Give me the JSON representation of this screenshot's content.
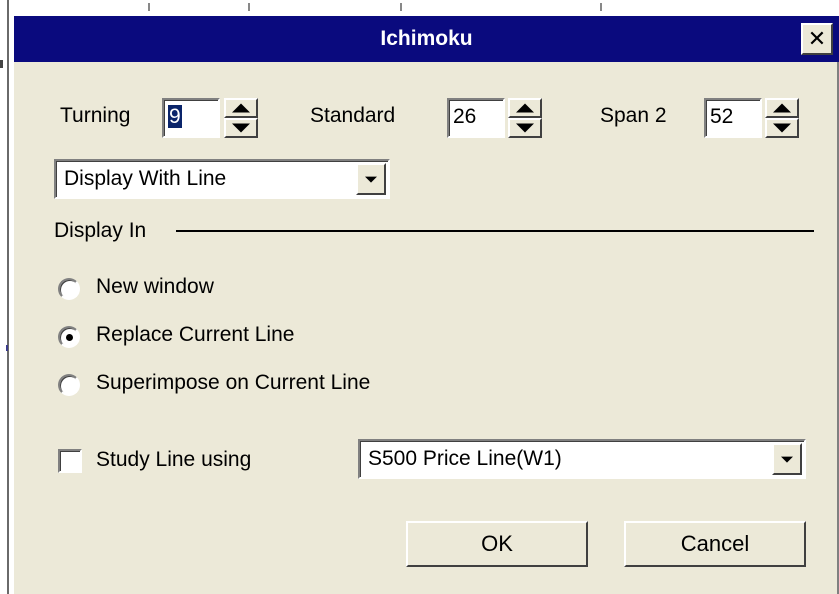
{
  "dialog": {
    "title": "Ichimoku",
    "close_label": "✕"
  },
  "params": {
    "turning": {
      "label": "Turning",
      "value": "9"
    },
    "standard": {
      "label": "Standard",
      "value": "26"
    },
    "span2": {
      "label": "Span 2",
      "value": "52"
    }
  },
  "display_mode": {
    "selected": "Display With Line"
  },
  "display_in": {
    "label": "Display In",
    "options": [
      {
        "label": "New window",
        "checked": false
      },
      {
        "label": "Replace Current Line",
        "checked": true
      },
      {
        "label": "Superimpose on Current Line",
        "checked": false
      }
    ]
  },
  "study_line": {
    "checkbox_label": "Study Line using",
    "checked": false,
    "selected": "S500 Price Line(W1)"
  },
  "buttons": {
    "ok": "OK",
    "cancel": "Cancel"
  },
  "icons": [
    "close-icon",
    "spin-up-icon",
    "spin-down-icon",
    "dropdown-arrow-icon",
    "radio-dot-icon"
  ]
}
